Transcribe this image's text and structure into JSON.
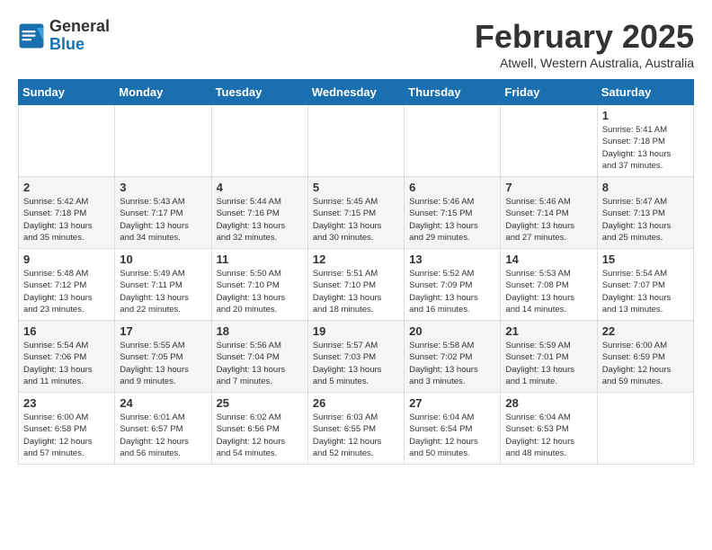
{
  "header": {
    "logo_general": "General",
    "logo_blue": "Blue",
    "month_title": "February 2025",
    "location": "Atwell, Western Australia, Australia"
  },
  "weekdays": [
    "Sunday",
    "Monday",
    "Tuesday",
    "Wednesday",
    "Thursday",
    "Friday",
    "Saturday"
  ],
  "weeks": [
    [
      {
        "day": "",
        "info": ""
      },
      {
        "day": "",
        "info": ""
      },
      {
        "day": "",
        "info": ""
      },
      {
        "day": "",
        "info": ""
      },
      {
        "day": "",
        "info": ""
      },
      {
        "day": "",
        "info": ""
      },
      {
        "day": "1",
        "info": "Sunrise: 5:41 AM\nSunset: 7:18 PM\nDaylight: 13 hours\nand 37 minutes."
      }
    ],
    [
      {
        "day": "2",
        "info": "Sunrise: 5:42 AM\nSunset: 7:18 PM\nDaylight: 13 hours\nand 35 minutes."
      },
      {
        "day": "3",
        "info": "Sunrise: 5:43 AM\nSunset: 7:17 PM\nDaylight: 13 hours\nand 34 minutes."
      },
      {
        "day": "4",
        "info": "Sunrise: 5:44 AM\nSunset: 7:16 PM\nDaylight: 13 hours\nand 32 minutes."
      },
      {
        "day": "5",
        "info": "Sunrise: 5:45 AM\nSunset: 7:15 PM\nDaylight: 13 hours\nand 30 minutes."
      },
      {
        "day": "6",
        "info": "Sunrise: 5:46 AM\nSunset: 7:15 PM\nDaylight: 13 hours\nand 29 minutes."
      },
      {
        "day": "7",
        "info": "Sunrise: 5:46 AM\nSunset: 7:14 PM\nDaylight: 13 hours\nand 27 minutes."
      },
      {
        "day": "8",
        "info": "Sunrise: 5:47 AM\nSunset: 7:13 PM\nDaylight: 13 hours\nand 25 minutes."
      }
    ],
    [
      {
        "day": "9",
        "info": "Sunrise: 5:48 AM\nSunset: 7:12 PM\nDaylight: 13 hours\nand 23 minutes."
      },
      {
        "day": "10",
        "info": "Sunrise: 5:49 AM\nSunset: 7:11 PM\nDaylight: 13 hours\nand 22 minutes."
      },
      {
        "day": "11",
        "info": "Sunrise: 5:50 AM\nSunset: 7:10 PM\nDaylight: 13 hours\nand 20 minutes."
      },
      {
        "day": "12",
        "info": "Sunrise: 5:51 AM\nSunset: 7:10 PM\nDaylight: 13 hours\nand 18 minutes."
      },
      {
        "day": "13",
        "info": "Sunrise: 5:52 AM\nSunset: 7:09 PM\nDaylight: 13 hours\nand 16 minutes."
      },
      {
        "day": "14",
        "info": "Sunrise: 5:53 AM\nSunset: 7:08 PM\nDaylight: 13 hours\nand 14 minutes."
      },
      {
        "day": "15",
        "info": "Sunrise: 5:54 AM\nSunset: 7:07 PM\nDaylight: 13 hours\nand 13 minutes."
      }
    ],
    [
      {
        "day": "16",
        "info": "Sunrise: 5:54 AM\nSunset: 7:06 PM\nDaylight: 13 hours\nand 11 minutes."
      },
      {
        "day": "17",
        "info": "Sunrise: 5:55 AM\nSunset: 7:05 PM\nDaylight: 13 hours\nand 9 minutes."
      },
      {
        "day": "18",
        "info": "Sunrise: 5:56 AM\nSunset: 7:04 PM\nDaylight: 13 hours\nand 7 minutes."
      },
      {
        "day": "19",
        "info": "Sunrise: 5:57 AM\nSunset: 7:03 PM\nDaylight: 13 hours\nand 5 minutes."
      },
      {
        "day": "20",
        "info": "Sunrise: 5:58 AM\nSunset: 7:02 PM\nDaylight: 13 hours\nand 3 minutes."
      },
      {
        "day": "21",
        "info": "Sunrise: 5:59 AM\nSunset: 7:01 PM\nDaylight: 13 hours\nand 1 minute."
      },
      {
        "day": "22",
        "info": "Sunrise: 6:00 AM\nSunset: 6:59 PM\nDaylight: 12 hours\nand 59 minutes."
      }
    ],
    [
      {
        "day": "23",
        "info": "Sunrise: 6:00 AM\nSunset: 6:58 PM\nDaylight: 12 hours\nand 57 minutes."
      },
      {
        "day": "24",
        "info": "Sunrise: 6:01 AM\nSunset: 6:57 PM\nDaylight: 12 hours\nand 56 minutes."
      },
      {
        "day": "25",
        "info": "Sunrise: 6:02 AM\nSunset: 6:56 PM\nDaylight: 12 hours\nand 54 minutes."
      },
      {
        "day": "26",
        "info": "Sunrise: 6:03 AM\nSunset: 6:55 PM\nDaylight: 12 hours\nand 52 minutes."
      },
      {
        "day": "27",
        "info": "Sunrise: 6:04 AM\nSunset: 6:54 PM\nDaylight: 12 hours\nand 50 minutes."
      },
      {
        "day": "28",
        "info": "Sunrise: 6:04 AM\nSunset: 6:53 PM\nDaylight: 12 hours\nand 48 minutes."
      },
      {
        "day": "",
        "info": ""
      }
    ]
  ]
}
